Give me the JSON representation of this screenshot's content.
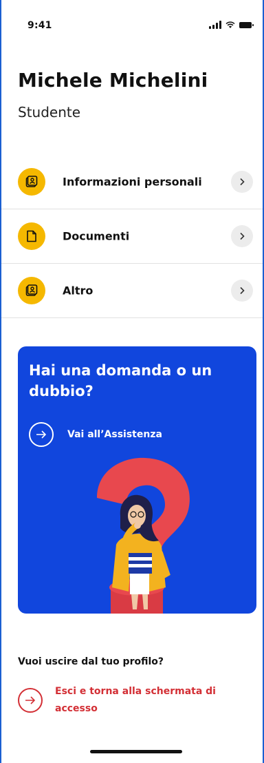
{
  "status_bar": {
    "time": "9:41"
  },
  "profile": {
    "name": "Michele Michelini",
    "role": "Studente"
  },
  "menu": {
    "items": [
      {
        "label": "Informazioni personali",
        "icon": "id-card-icon"
      },
      {
        "label": "Documenti",
        "icon": "document-icon"
      },
      {
        "label": "Altro",
        "icon": "id-card-icon"
      }
    ]
  },
  "help_card": {
    "title": "Hai una domanda o un dubbio?",
    "link_label": "Vai all’Assistenza",
    "background": "#1146dd"
  },
  "exit": {
    "question": "Vuoi uscire dal tuo profilo?",
    "link_label": "Esci e torna alla schermata di accesso",
    "color": "#d32f35"
  },
  "colors": {
    "accent": "#f5b800",
    "frame": "#1b5fd1"
  }
}
